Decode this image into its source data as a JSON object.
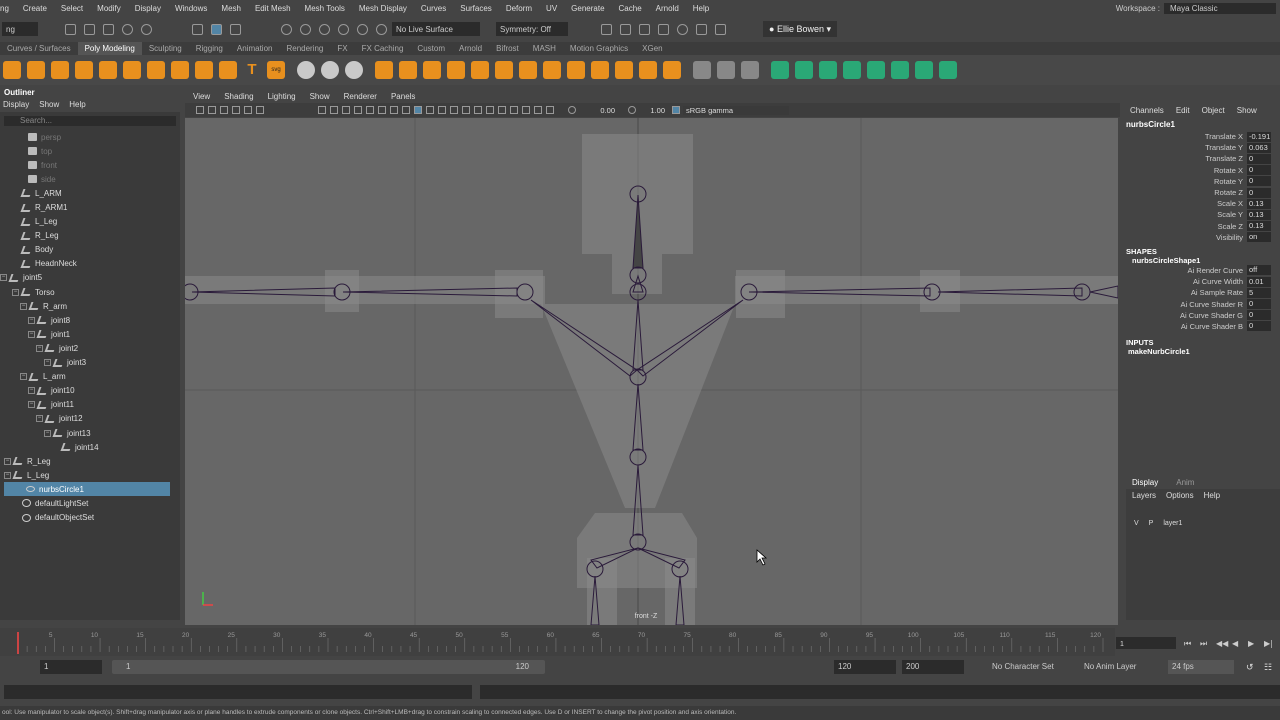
{
  "menubar": {
    "items": [
      "ng",
      "Create",
      "Select",
      "Modify",
      "Display",
      "Windows",
      "Mesh",
      "Edit Mesh",
      "Mesh Tools",
      "Mesh Display",
      "Curves",
      "Surfaces",
      "Deform",
      "UV",
      "Generate",
      "Cache",
      "Arnold",
      "Help"
    ],
    "workspace_label": "Workspace :",
    "workspace_value": "Maya Classic"
  },
  "statusline": {
    "mode": "ng",
    "live_surface": "No Live Surface",
    "symmetry": "Symmetry: Off",
    "user": "Ellie Bowen"
  },
  "shelf": {
    "tabs": [
      "Curves / Surfaces",
      "Poly Modeling",
      "Sculpting",
      "Rigging",
      "Animation",
      "Rendering",
      "FX",
      "FX Caching",
      "Custom",
      "Arnold",
      "Bifrost",
      "MASH",
      "Motion Graphics",
      "XGen"
    ],
    "active_tab": "Poly Modeling",
    "text_icons": [
      "T",
      "svg"
    ]
  },
  "outliner": {
    "title": "Outliner",
    "menu": [
      "Display",
      "Show",
      "Help"
    ],
    "search_placeholder": "Search...",
    "rows": [
      {
        "label": "persp",
        "dim": true
      },
      {
        "label": "top",
        "dim": true
      },
      {
        "label": "front",
        "dim": true
      },
      {
        "label": "side",
        "dim": true
      },
      {
        "label": "L_ARM"
      },
      {
        "label": "R_ARM1"
      },
      {
        "label": "L_Leg"
      },
      {
        "label": "R_Leg"
      },
      {
        "label": "Body"
      },
      {
        "label": "HeadnNeck"
      },
      {
        "label": "joint5"
      },
      {
        "label": "Torso"
      },
      {
        "label": "R_arm"
      },
      {
        "label": "joint8"
      },
      {
        "label": "joint1"
      },
      {
        "label": "joint2"
      },
      {
        "label": "joint3"
      },
      {
        "label": "L_arm"
      },
      {
        "label": "joint10"
      },
      {
        "label": "joint11"
      },
      {
        "label": "joint12"
      },
      {
        "label": "joint13"
      },
      {
        "label": "joint14"
      },
      {
        "label": "R_Leg"
      },
      {
        "label": "L_Leg"
      },
      {
        "label": "nurbsCircle1",
        "selected": true
      },
      {
        "label": "defaultLightSet"
      },
      {
        "label": "defaultObjectSet"
      }
    ]
  },
  "viewport": {
    "menu": [
      "View",
      "Shading",
      "Lighting",
      "Show",
      "Renderer",
      "Panels"
    ],
    "exposure": "0.00",
    "gamma": "1.00",
    "colorspace": "sRGB gamma",
    "camera_label": "front -Z"
  },
  "channel_box": {
    "menu": [
      "Channels",
      "Edit",
      "Object",
      "Show"
    ],
    "object": "nurbsCircle1",
    "channels": [
      {
        "label": "Translate X",
        "value": "-0.191"
      },
      {
        "label": "Translate Y",
        "value": "0.063"
      },
      {
        "label": "Translate Z",
        "value": "0"
      },
      {
        "label": "Rotate X",
        "value": "0"
      },
      {
        "label": "Rotate Y",
        "value": "0"
      },
      {
        "label": "Rotate Z",
        "value": "0"
      },
      {
        "label": "Scale X",
        "value": "0.13"
      },
      {
        "label": "Scale Y",
        "value": "0.13"
      },
      {
        "label": "Scale Z",
        "value": "0.13"
      },
      {
        "label": "Visibility",
        "value": "on"
      }
    ],
    "shapes_header": "SHAPES",
    "shape_name": "nurbsCircleShape1",
    "shape_channels": [
      {
        "label": "Ai Render Curve",
        "value": "off"
      },
      {
        "label": "Ai Curve Width",
        "value": "0.01"
      },
      {
        "label": "Ai Sample Rate",
        "value": "5"
      },
      {
        "label": "Ai Curve Shader R",
        "value": "0"
      },
      {
        "label": "Ai Curve Shader G",
        "value": "0"
      },
      {
        "label": "Ai Curve Shader B",
        "value": "0"
      }
    ],
    "inputs_header": "INPUTS",
    "input_name": "makeNurbCircle1"
  },
  "layer_editor": {
    "tabs": [
      "Display",
      "Anim"
    ],
    "menu": [
      "Layers",
      "Options",
      "Help"
    ],
    "v": "V",
    "p": "P",
    "layer": "layer1"
  },
  "timeline": {
    "ticks": [
      "5",
      "10",
      "15",
      "20",
      "25",
      "30",
      "35",
      "40",
      "45",
      "50",
      "55",
      "60",
      "65",
      "70",
      "75",
      "80",
      "85",
      "90",
      "95",
      "100",
      "105",
      "110",
      "115",
      "120"
    ],
    "current_frame": "1"
  },
  "range": {
    "start": "1",
    "slider_start": "1",
    "slider_end": "120",
    "end": "120",
    "max": "200",
    "char_set": "No Character Set",
    "anim_layer": "No Anim Layer",
    "fps": "24 fps"
  },
  "help_line": "ool: Use manipulator to scale object(s). Shift+drag manipulator axis or plane handles to extrude components or clone objects. Ctrl+Shift+LMB+drag to constrain scaling to connected edges. Use D or INSERT to change the pivot position and axis orientation."
}
